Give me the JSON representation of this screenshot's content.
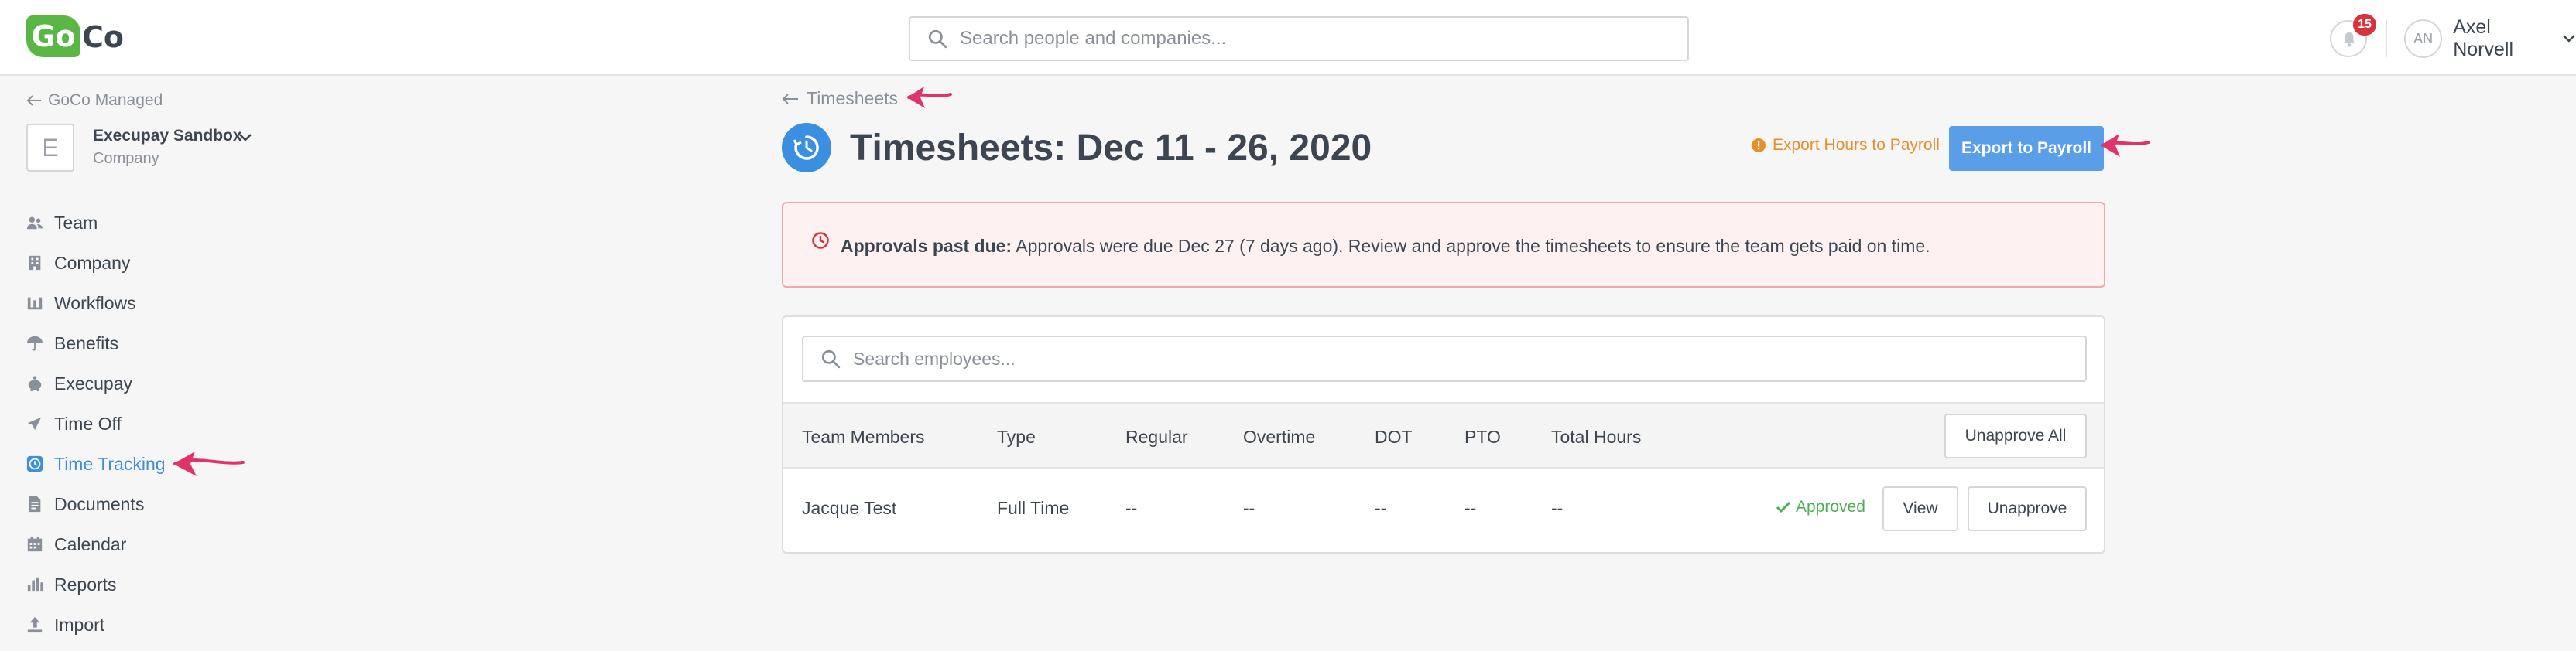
{
  "header": {
    "logo_go": "Go",
    "logo_co": "Co",
    "search_placeholder": "Search people and companies...",
    "notification_count": "15",
    "avatar_initials": "AN",
    "user_name": "Axel Norvell"
  },
  "sidebar": {
    "managed_link": "GoCo Managed",
    "company_initial": "E",
    "company_name": "Execupay Sandbox",
    "company_type": "Company",
    "items": [
      {
        "label": "Team",
        "icon": "team-icon"
      },
      {
        "label": "Company",
        "icon": "building-icon"
      },
      {
        "label": "Workflows",
        "icon": "workflow-icon"
      },
      {
        "label": "Benefits",
        "icon": "umbrella-icon"
      },
      {
        "label": "Execupay",
        "icon": "piggy-bank-icon"
      },
      {
        "label": "Time Off",
        "icon": "plane-icon"
      },
      {
        "label": "Time Tracking",
        "icon": "clock-icon",
        "active": true
      },
      {
        "label": "Documents",
        "icon": "document-icon"
      },
      {
        "label": "Calendar",
        "icon": "calendar-icon"
      },
      {
        "label": "Reports",
        "icon": "bar-chart-icon"
      },
      {
        "label": "Import",
        "icon": "upload-icon"
      }
    ]
  },
  "main": {
    "back_link": "Timesheets",
    "title": "Timesheets: Dec 11 - 26, 2020",
    "export_hours_link": "Export Hours to Payroll",
    "export_button": "Export to Payroll",
    "alert": {
      "bold": "Approvals past due:",
      "text": " Approvals were due Dec 27 (7 days ago). Review and approve the timesheets to ensure the team gets paid on time."
    },
    "employee_search_placeholder": "Search employees...",
    "table": {
      "headers": [
        "Team Members",
        "Type",
        "Regular",
        "Overtime",
        "DOT",
        "PTO",
        "Total Hours"
      ],
      "unapprove_all": "Unapprove All",
      "rows": [
        {
          "name": "Jacque Test",
          "type": "Full Time",
          "regular": "--",
          "overtime": "--",
          "dot": "--",
          "pto": "--",
          "total": "--",
          "status": "Approved",
          "view": "View",
          "unapprove": "Unapprove"
        }
      ]
    }
  },
  "colors": {
    "accent": "#3b8fe0",
    "brand_green": "#5bb745",
    "warning": "#e88e2a",
    "success": "#4caf50",
    "alert_bg": "#fdf1f1",
    "annotation_arrow": "#e0336a"
  }
}
